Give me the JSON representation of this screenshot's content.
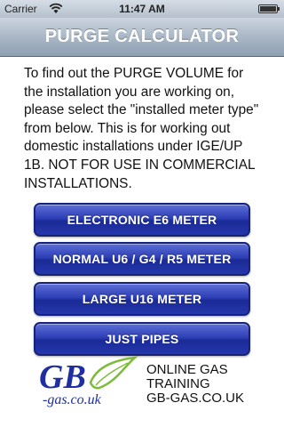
{
  "status_bar": {
    "carrier": "Carrier",
    "time": "11:47 AM",
    "icons": [
      "wifi-icon",
      "battery-icon"
    ]
  },
  "nav": {
    "title": "PURGE CALCULATOR"
  },
  "intro": {
    "text": "To find out the PURGE VOLUME for the installation you are working on, please select the \"installed meter type\" from below. This is for working out domestic installations under IGE/UP 1B. NOT FOR USE IN COMMERCIAL INSTALLATIONS."
  },
  "buttons": [
    {
      "label": "ELECTRONIC E6 METER"
    },
    {
      "label": "NORMAL U6 / G4 / R5 METER"
    },
    {
      "label": "LARGE U16  METER"
    },
    {
      "label": "JUST PIPES"
    }
  ],
  "footer": {
    "logo_text": "GB",
    "logo_subtext": "-gas.co.uk",
    "line1": "ONLINE GAS",
    "line2": "TRAINING",
    "line3": "GB-GAS.CO.UK"
  },
  "colors": {
    "button_blue": "#2d3fb6",
    "nav_gradient_top": "#ccd5df",
    "nav_gradient_bottom": "#8fa0b3",
    "logo_blue": "#1f2fa0",
    "logo_green": "#7dbb3c"
  }
}
